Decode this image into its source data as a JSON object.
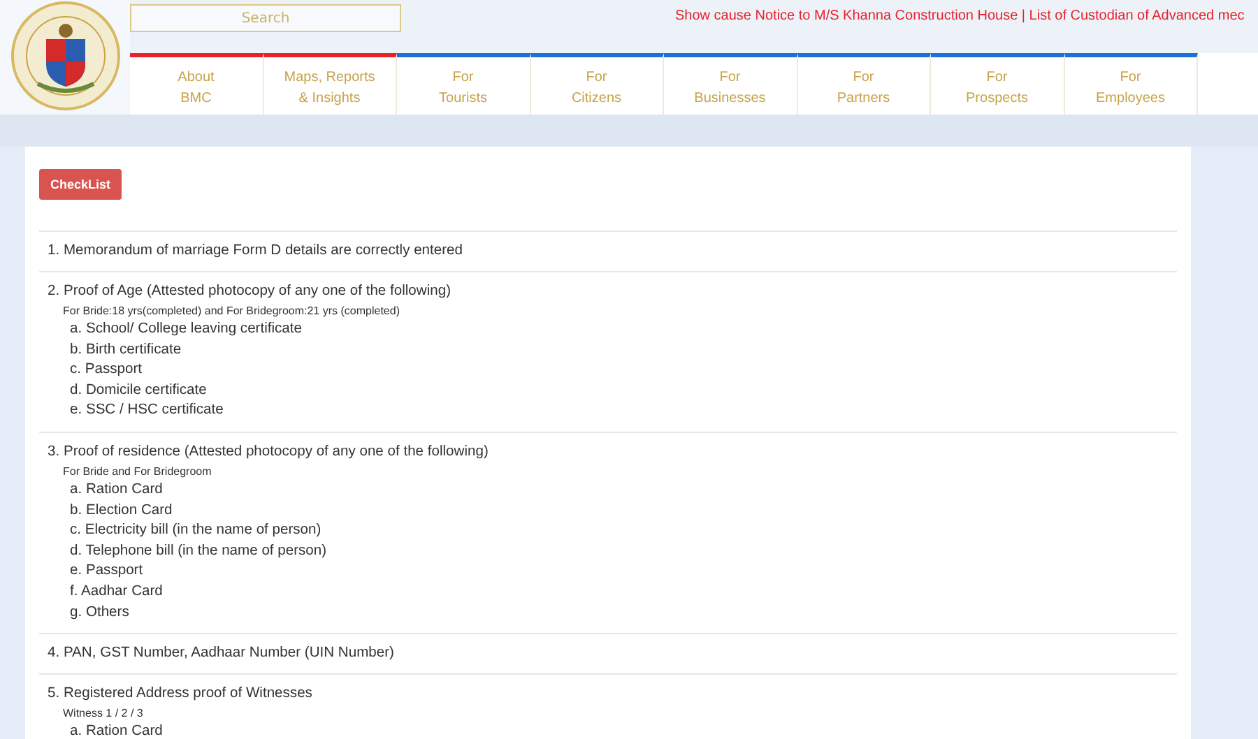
{
  "header": {
    "search": {
      "placeholder": "Search"
    },
    "ticker": "Show cause Notice to M/S Khanna Construction House | List of Custodian of Advanced mec"
  },
  "nav": [
    {
      "line1": "About",
      "line2": "BMC",
      "color": "#e8212b"
    },
    {
      "line1": "Maps, Reports",
      "line2": "& Insights",
      "color": "#e8212b"
    },
    {
      "line1": "For",
      "line2": "Tourists",
      "color": "#1e6fd9"
    },
    {
      "line1": "For",
      "line2": "Citizens",
      "color": "#1e6fd9"
    },
    {
      "line1": "For",
      "line2": "Businesses",
      "color": "#1e6fd9"
    },
    {
      "line1": "For",
      "line2": "Partners",
      "color": "#1e6fd9"
    },
    {
      "line1": "For",
      "line2": "Prospects",
      "color": "#1e6fd9"
    },
    {
      "line1": "For",
      "line2": "Employees",
      "color": "#1e6fd9"
    }
  ],
  "checklist_button": "CheckList",
  "items": [
    {
      "title": "1. Memorandum of marriage Form D details are correctly entered"
    },
    {
      "title": "2. Proof of Age (Attested photocopy of any one of the following)",
      "note": "For Bride:18 yrs(completed) and For Bridegroom:21 yrs (completed)",
      "options": [
        "a. School/ College leaving certificate",
        "b. Birth certificate",
        "c. Passport",
        "d. Domicile certificate",
        "e. SSC / HSC certificate"
      ]
    },
    {
      "title": "3. Proof of residence (Attested photocopy of any one of the following)",
      "note": "For Bride and For Bridegroom",
      "options": [
        "a. Ration Card",
        "b. Election Card",
        "c. Electricity bill (in the name of person)",
        "d. Telephone bill (in the name of person)",
        "e. Passport",
        "f. Aadhar Card",
        "g. Others"
      ]
    },
    {
      "title": "4. PAN, GST Number, Aadhaar Number (UIN Number)"
    },
    {
      "title": "5. Registered Address proof of Witnesses",
      "note": "Witness 1 / 2 / 3",
      "options": [
        "a. Ration Card"
      ]
    }
  ]
}
